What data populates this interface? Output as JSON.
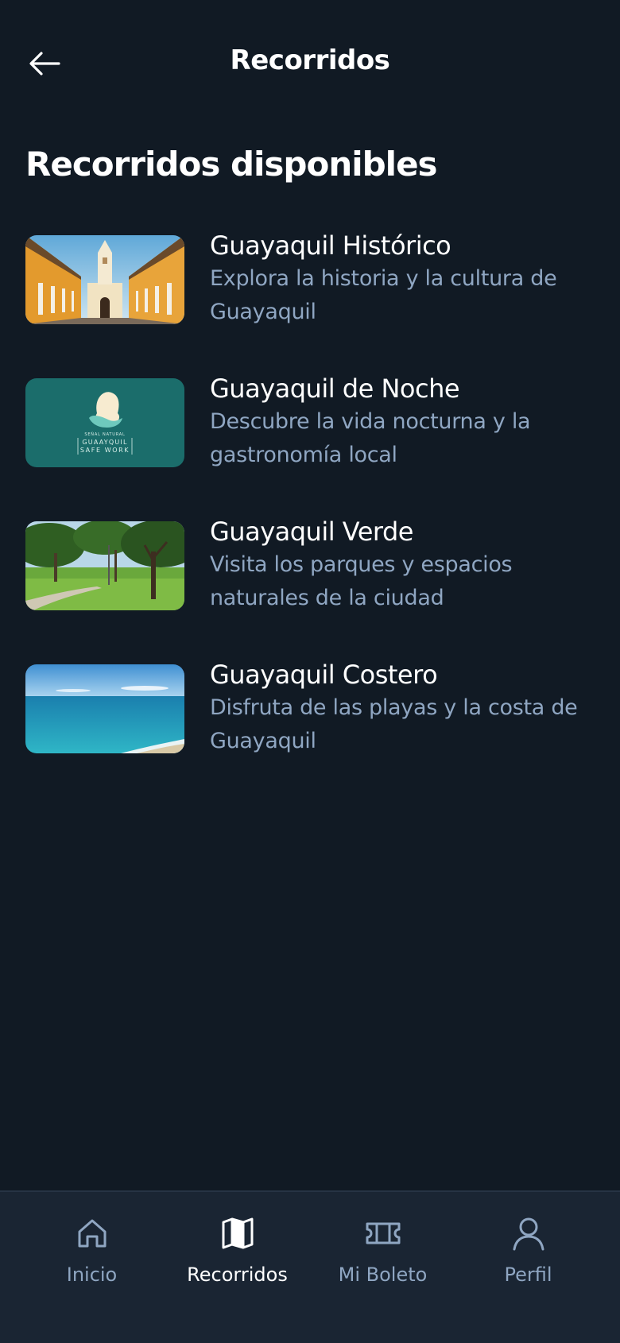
{
  "header": {
    "title": "Recorridos",
    "back_icon": "arrow-left-icon"
  },
  "section": {
    "heading": "Recorridos disponibles"
  },
  "tours": [
    {
      "title": "Guayaquil Histórico",
      "description": "Explora la historia y la cultura de Guayaquil",
      "image": "colonial-church-street-image"
    },
    {
      "title": "Guayaquil de Noche",
      "description": "Descubre la vida nocturna y la gastronomía local",
      "image": "teal-logo-image"
    },
    {
      "title": "Guayaquil Verde",
      "description": "Visita los parques y espacios naturales de la ciudad",
      "image": "green-park-image"
    },
    {
      "title": "Guayaquil Costero",
      "description": "Disfruta de las playas y la costa de Guayaquil",
      "image": "ocean-beach-image"
    }
  ],
  "logo_text": {
    "line1": "SEÑAL NATURAL",
    "line2": "GUAAYQUIL",
    "line3": "SAFE WORK"
  },
  "nav": {
    "items": [
      {
        "label": "Inicio",
        "icon": "home-icon",
        "active": false
      },
      {
        "label": "Recorridos",
        "icon": "map-icon",
        "active": true
      },
      {
        "label": "Mi Boleto",
        "icon": "ticket-icon",
        "active": false
      },
      {
        "label": "Perfil",
        "icon": "user-icon",
        "active": false
      }
    ]
  },
  "colors": {
    "background": "#111a24",
    "nav_background": "#1a2533",
    "muted_text": "#8fa6c2",
    "active": "#ffffff"
  }
}
